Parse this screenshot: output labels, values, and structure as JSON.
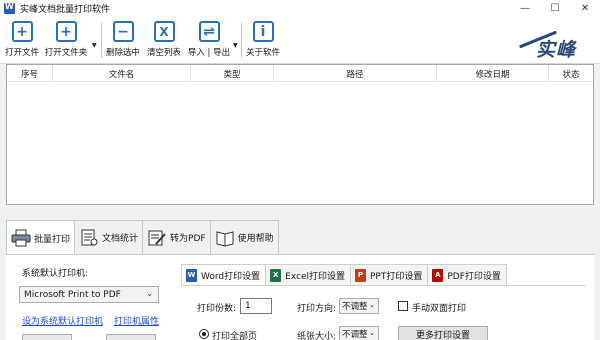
{
  "window": {
    "title": "实峰文档批量打印软件",
    "controls": [
      "—",
      "☐",
      "✕"
    ]
  },
  "toolbar": {
    "buttons": [
      {
        "label": "打开文件",
        "icon": "+"
      },
      {
        "label": "打开文件夹",
        "icon": "+"
      },
      {
        "label": "删除选中",
        "icon": "−"
      },
      {
        "label": "清空列表",
        "icon": "X"
      },
      {
        "label": "导入 | 导出",
        "icon": "⇌"
      },
      {
        "label": "关于软件",
        "icon": "i"
      }
    ],
    "brand": "实峰",
    "accent": "#2a6fb8"
  },
  "file_list": {
    "columns": [
      "序号",
      "文件名",
      "类型",
      "路径",
      "修改日期",
      "状态"
    ],
    "rows": []
  },
  "main_tabs": [
    {
      "label": "批量打印",
      "icon": "printer-icon"
    },
    {
      "label": "文档统计",
      "icon": "document-stats-icon"
    },
    {
      "label": "转为PDF",
      "icon": "convert-pdf-icon"
    },
    {
      "label": "使用帮助",
      "icon": "help-icon"
    }
  ],
  "printer": {
    "label": "系统默认打印机:",
    "selected": "Microsoft Print to PDF",
    "set_default_link": "设为系统默认打印机",
    "properties_link": "打印机属性"
  },
  "settings_tabs": [
    {
      "label": "Word打印设置",
      "icon_letter": "W",
      "color": "#2b5fb4"
    },
    {
      "label": "Excel打印设置",
      "icon_letter": "X",
      "color": "#1e7145"
    },
    {
      "label": "PPT打印设置",
      "icon_letter": "P",
      "color": "#c43e1c"
    },
    {
      "label": "PDF打印设置",
      "icon_letter": "A",
      "color": "#b30b00"
    }
  ],
  "word_settings": {
    "copies_label": "打印份数:",
    "copies_value": "1",
    "direction_label": "打印方向:",
    "direction_value": "不调整",
    "duplex_label": "手动双面打印",
    "all_pages_label": "打印全部页",
    "paper_label": "纸张大小:",
    "paper_value": "不调整",
    "more_button": "更多打印设置"
  }
}
